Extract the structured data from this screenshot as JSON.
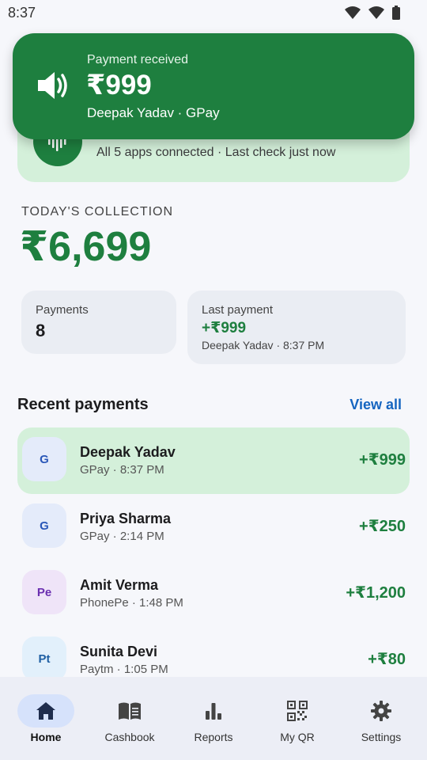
{
  "status_bar": {
    "time": "8:37"
  },
  "notification": {
    "title": "Payment received",
    "amount": "₹999",
    "subtitle": "Deepak Yadav · GPay"
  },
  "listening_card": {
    "title": "",
    "subtitle": "All 5 apps connected · Last check just now"
  },
  "today": {
    "label": "TODAY'S COLLECTION",
    "amount": "₹6,699"
  },
  "stats": {
    "payments_label": "Payments",
    "payments_value": "8",
    "last_label": "Last payment",
    "last_amount": "+₹999",
    "last_sub": "Deepak Yadav · 8:37 PM"
  },
  "recent": {
    "title": "Recent payments",
    "view_all": "View all",
    "items": [
      {
        "initials": "G",
        "name": "Deepak Yadav",
        "meta": "GPay · 8:37 PM",
        "amount": "+₹999"
      },
      {
        "initials": "G",
        "name": "Priya Sharma",
        "meta": "GPay · 2:14 PM",
        "amount": "+₹250"
      },
      {
        "initials": "Pe",
        "name": "Amit Verma",
        "meta": "PhonePe · 1:48 PM",
        "amount": "+₹1,200"
      },
      {
        "initials": "Pt",
        "name": "Sunita Devi",
        "meta": "Paytm · 1:05 PM",
        "amount": "+₹80"
      }
    ]
  },
  "nav": {
    "items": [
      {
        "label": "Home",
        "icon": "home-icon"
      },
      {
        "label": "Cashbook",
        "icon": "book-icon"
      },
      {
        "label": "Reports",
        "icon": "bar-chart-icon"
      },
      {
        "label": "My QR",
        "icon": "qr-code-icon"
      },
      {
        "label": "Settings",
        "icon": "gear-icon"
      }
    ],
    "active": "Home"
  },
  "colors": {
    "primary_green": "#1e7f3f",
    "light_green": "#d4f0da",
    "link_blue": "#1565c0",
    "nav_active": "#d6e2fb"
  }
}
